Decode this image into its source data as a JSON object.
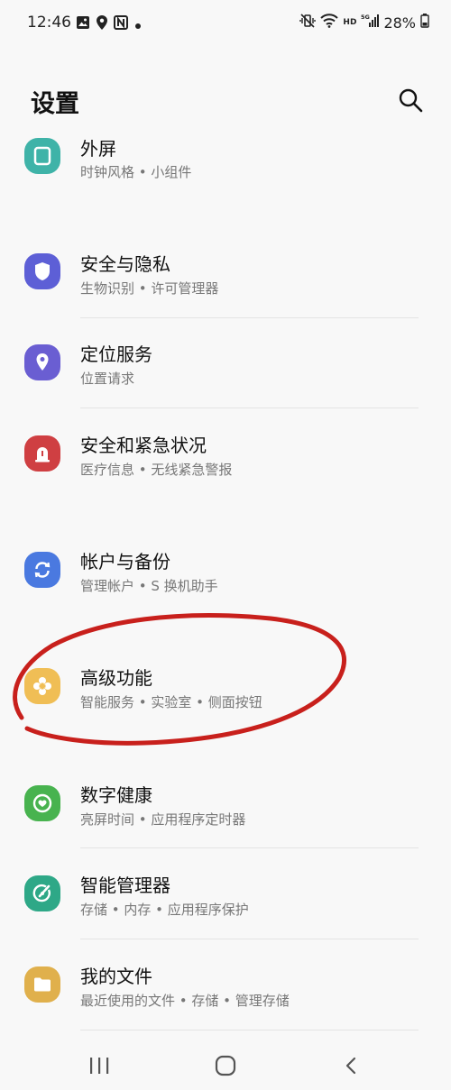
{
  "status_bar": {
    "time": "12:46",
    "left_icons": [
      "gallery-icon",
      "location-pin-icon",
      "nfc-icon",
      "dot-icon"
    ],
    "network_label": "HD",
    "network_gen": "5G",
    "battery_percent": "28%"
  },
  "header": {
    "title": "设置",
    "search_icon": "search-icon"
  },
  "settings": [
    {
      "title": "外屏",
      "subtitle": "时钟风格 • 小组件",
      "icon": "external-screen-icon",
      "color": "#3fb3a8"
    },
    {
      "title": "安全与隐私",
      "subtitle": "生物识别 • 许可管理器",
      "icon": "shield-icon",
      "color": "#5d5fd6"
    },
    {
      "title": "定位服务",
      "subtitle": "位置请求",
      "icon": "location-icon",
      "color": "#6a5ed2"
    },
    {
      "title": "安全和紧急状况",
      "subtitle": "医疗信息 • 无线紧急警报",
      "icon": "emergency-icon",
      "color": "#cf3f42"
    },
    {
      "title": "帐户与备份",
      "subtitle": "管理帐户 • S 换机助手",
      "icon": "sync-icon",
      "color": "#4a79e0"
    },
    {
      "title": "高级功能",
      "subtitle": "智能服务 • 实验室 • 侧面按钮",
      "icon": "advanced-features-icon",
      "color": "#f0be55"
    },
    {
      "title": "数字健康",
      "subtitle": "亮屏时间 • 应用程序定时器",
      "icon": "digital-wellbeing-icon",
      "color": "#48b34f"
    },
    {
      "title": "智能管理器",
      "subtitle": "存储 • 内存 • 应用程序保护",
      "icon": "device-care-icon",
      "color": "#2ea887"
    },
    {
      "title": "我的文件",
      "subtitle": "最近使用的文件 • 存储 • 管理存储",
      "icon": "folder-icon",
      "color": "#e0b04c"
    }
  ],
  "annotation": {
    "shape": "hand-drawn-ellipse",
    "color": "#c8201c",
    "circles_item": "高级功能"
  },
  "nav_bar": {
    "recents_icon": "recents-icon",
    "home_icon": "home-icon",
    "back_icon": "back-icon"
  }
}
